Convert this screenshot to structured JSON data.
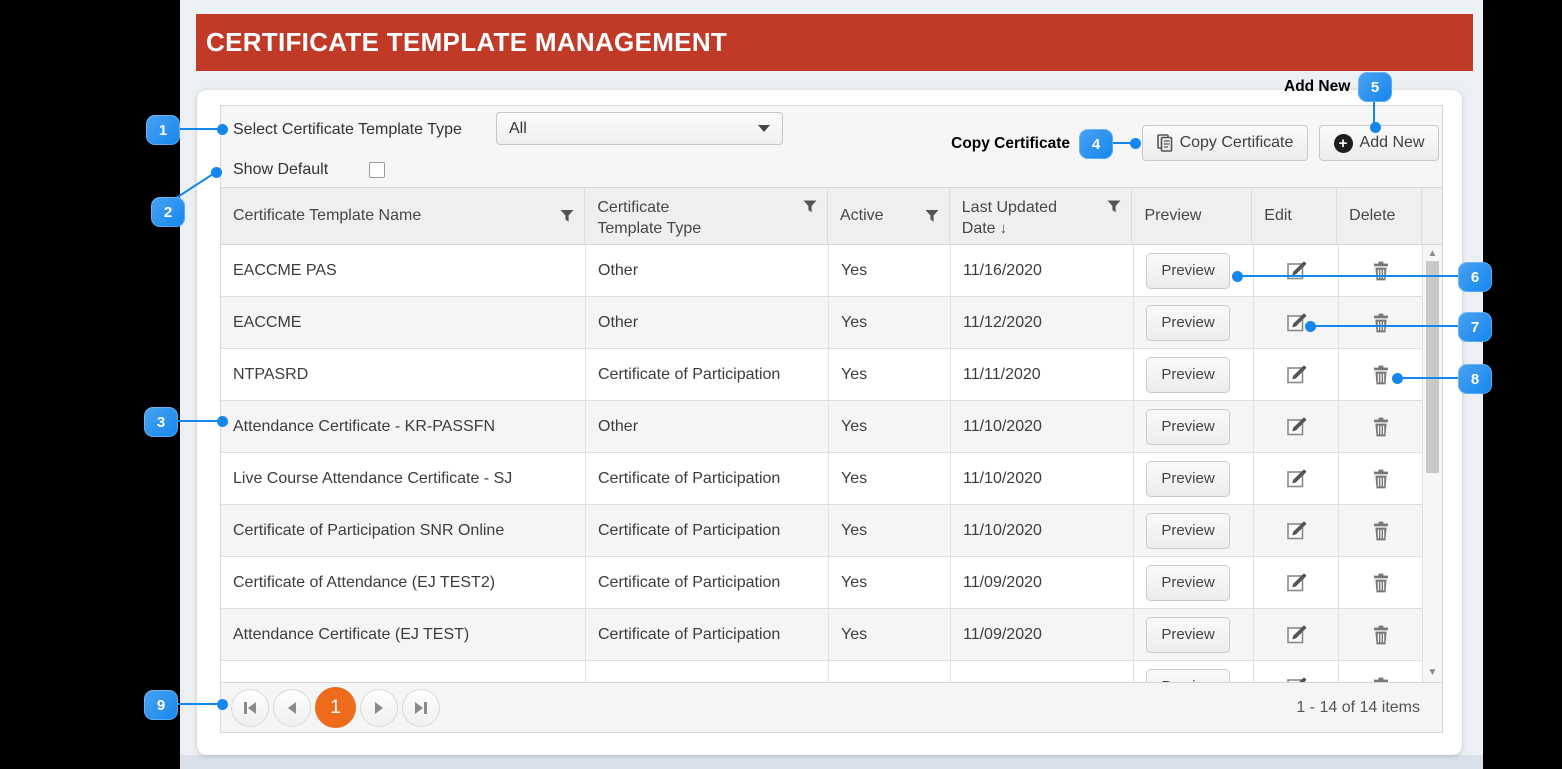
{
  "page": {
    "title": "CERTIFICATE TEMPLATE MANAGEMENT"
  },
  "colors": {
    "header_red": "#C13A27",
    "annotation_blue": "#1486ED",
    "active_page_orange": "#EF6B1C"
  },
  "toolbar": {
    "select_type_label": "Select Certificate Template Type",
    "select_type_value": "All",
    "show_default_label": "Show Default",
    "copy_certificate_label": "Copy Certificate",
    "add_new_label": "Add New"
  },
  "annotations": {
    "copy_label": "Copy Certificate",
    "add_label": "Add New",
    "badges": [
      "1",
      "2",
      "3",
      "4",
      "5",
      "6",
      "7",
      "8",
      "9"
    ]
  },
  "grid": {
    "headers": {
      "name": "Certificate Template Name",
      "type": "Certificate Template Type",
      "active": "Active",
      "date": "Last Updated Date",
      "preview": "Preview",
      "edit": "Edit",
      "delete": "Delete"
    },
    "sort_indicator": "↓",
    "preview_label": "Preview",
    "rows": [
      {
        "name": "EACCME PAS",
        "type": "Other",
        "active": "Yes",
        "date": "11/16/2020"
      },
      {
        "name": "EACCME",
        "type": "Other",
        "active": "Yes",
        "date": "11/12/2020"
      },
      {
        "name": "NTPASRD",
        "type": "Certificate of Participation",
        "active": "Yes",
        "date": "11/11/2020"
      },
      {
        "name": "Attendance Certificate - KR-PASSFN",
        "type": "Other",
        "active": "Yes",
        "date": "11/10/2020"
      },
      {
        "name": "Live Course Attendance Certificate - SJ",
        "type": "Certificate of Participation",
        "active": "Yes",
        "date": "11/10/2020"
      },
      {
        "name": "Certificate of Participation SNR Online",
        "type": "Certificate of Participation",
        "active": "Yes",
        "date": "11/10/2020"
      },
      {
        "name": "Certificate of Attendance (EJ TEST2)",
        "type": "Certificate of Participation",
        "active": "Yes",
        "date": "11/09/2020"
      },
      {
        "name": "Attendance Certificate (EJ TEST)",
        "type": "Certificate of Participation",
        "active": "Yes",
        "date": "11/09/2020"
      }
    ],
    "partial_row": {
      "name": "",
      "type": "",
      "active": "",
      "date": ""
    },
    "pager": {
      "page": "1",
      "summary": "1 - 14 of 14 items"
    }
  }
}
